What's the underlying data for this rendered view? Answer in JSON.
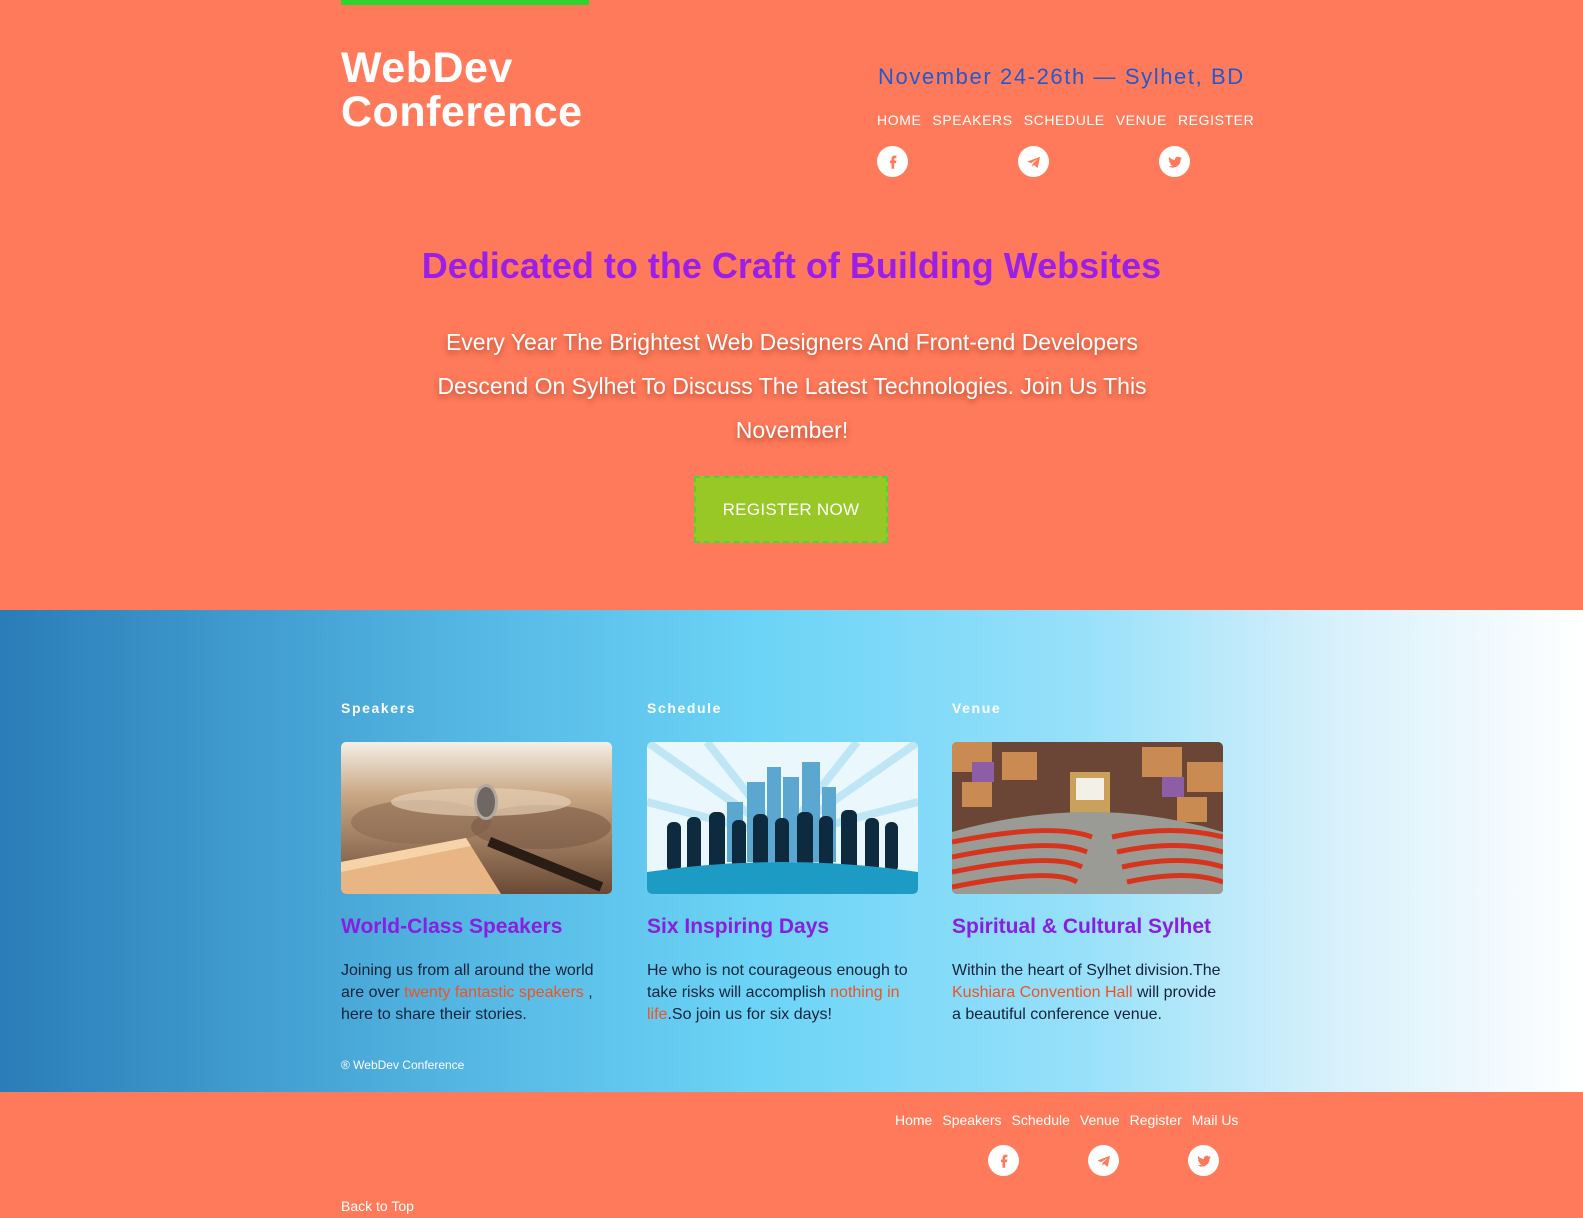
{
  "header": {
    "logo_line1": "WebDev",
    "logo_line2": "Conference",
    "event_date": "November 24-26th — Sylhet, BD",
    "nav": [
      "HOME",
      "SPEAKERS",
      "SCHEDULE",
      "VENUE",
      "REGISTER"
    ],
    "social": [
      "facebook-icon",
      "telegram-icon",
      "twitter-icon"
    ]
  },
  "hero": {
    "title": "Dedicated to the Craft of Building Websites",
    "text": "Every Year The Brightest Web Designers And Front-end Developers Descend On Sylhet To Discuss The Latest Technologies. Join Us This November!",
    "button": "REGISTER NOW"
  },
  "features": [
    {
      "label": "Speakers",
      "title": "World-Class Speakers",
      "text_before": "Joining us from all around the world are over ",
      "link": "twenty fantastic speakers",
      "text_after": " , here to share their stories."
    },
    {
      "label": "Schedule",
      "title": "Six Inspiring Days",
      "text_before": "He who is not courageous enough to take risks will accomplish ",
      "link": "nothing in life",
      "text_after": ".So join us for six days!"
    },
    {
      "label": "Venue",
      "title": "Spiritual & Cultural Sylhet",
      "text_before": "Within the heart of Sylhet division.The ",
      "link": "Kushiara Convention Hall",
      "text_after": " will provide a beautiful conference venue."
    }
  ],
  "copyright": "® WebDev Conference",
  "footer": {
    "nav": [
      "Home",
      "Speakers",
      "Schedule",
      "Venue",
      "Register",
      "Mail Us"
    ],
    "back_to_top": "Back to Top"
  },
  "colors": {
    "background": "#ff7a5a",
    "accent_purple": "#9b1fe8",
    "date_blue": "#1f5ad0",
    "button_green": "#98c826",
    "link_orange": "#ee5324"
  }
}
